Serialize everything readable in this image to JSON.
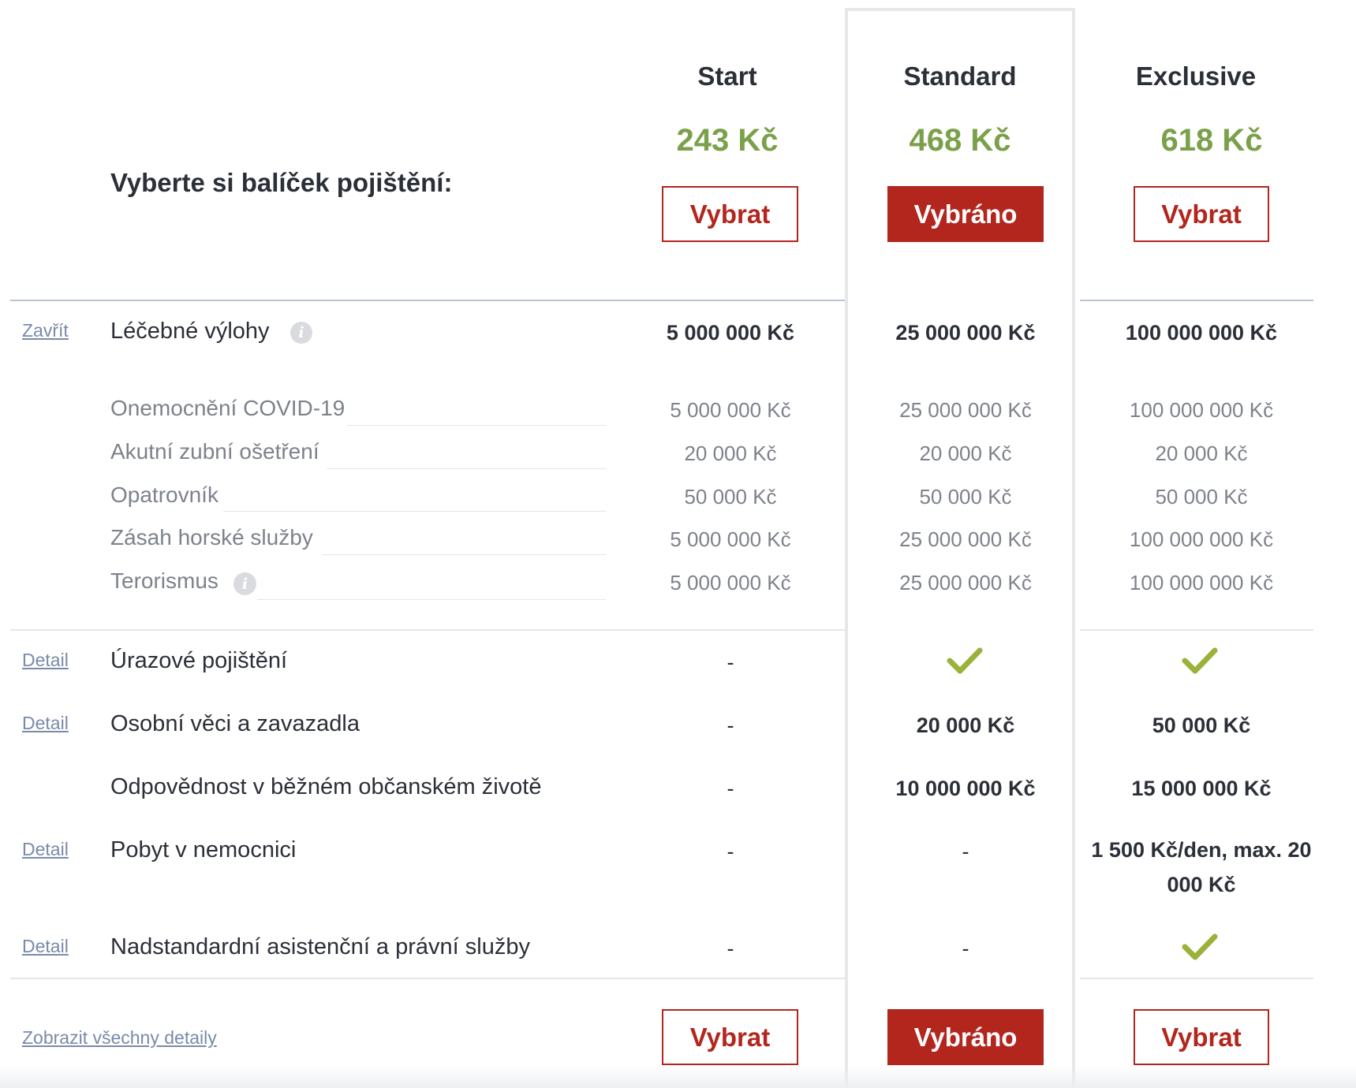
{
  "title": "Vyberte si balíček pojištění:",
  "colors": {
    "accent_red": "#b3261e",
    "price_green": "#7ba04a",
    "check_green": "#9ab23a",
    "link_gray": "#7a8aa8"
  },
  "plans": [
    {
      "name": "Start",
      "price": "243 Kč",
      "button": "Vybrat",
      "selected": false
    },
    {
      "name": "Standard",
      "price": "468 Kč",
      "button": "Vybráno",
      "selected": true
    },
    {
      "name": "Exclusive",
      "price": "618 Kč",
      "button": "Vybrat",
      "selected": false
    }
  ],
  "medical": {
    "toggle_link": "Zavřít",
    "label": "Léčebné výlohy",
    "info_icon": "info-icon",
    "values": [
      "5 000 000 Kč",
      "25 000 000 Kč",
      "100 000 000 Kč"
    ],
    "sub_rows": [
      {
        "label": "Onemocnění COVID-19",
        "values": [
          "5 000 000 Kč",
          "25 000 000 Kč",
          "100 000 000 Kč"
        ]
      },
      {
        "label": "Akutní zubní ošetření",
        "values": [
          "20 000 Kč",
          "20 000 Kč",
          "20 000 Kč"
        ]
      },
      {
        "label": "Opatrovník",
        "values": [
          "50 000 Kč",
          "50 000 Kč",
          "50 000 Kč"
        ]
      },
      {
        "label": "Zásah horské služby",
        "values": [
          "5 000 000 Kč",
          "25 000 000 Kč",
          "100 000 000 Kč"
        ]
      },
      {
        "label": "Terorismus",
        "values": [
          "5 000 000 Kč",
          "25 000 000 Kč",
          "100 000 000 Kč"
        ]
      }
    ]
  },
  "rows": [
    {
      "link": "Detail",
      "label": "Úrazové pojištění",
      "values": [
        "-",
        "check-icon",
        "check-icon"
      ]
    },
    {
      "link": "Detail",
      "label": "Osobní věci a zavazadla",
      "values": [
        "-",
        "20 000 Kč",
        "50 000 Kč"
      ]
    },
    {
      "link": "",
      "label": "Odpovědnost v běžném občanském životě",
      "values": [
        "-",
        "10 000 000 Kč",
        "15 000 000 Kč"
      ]
    },
    {
      "link": "Detail",
      "label": "Pobyt v nemocnici",
      "values": [
        "-",
        "-",
        "1 500 Kč/den, max. 20 000 Kč"
      ]
    },
    {
      "link": "Detail",
      "label": "Nadstandardní asistenční a právní služby",
      "values": [
        "-",
        "-",
        "check-icon"
      ]
    }
  ],
  "footer": {
    "show_all_link": "Zobrazit všechny detaily",
    "buttons": [
      "Vybrat",
      "Vybráno",
      "Vybrat"
    ]
  }
}
